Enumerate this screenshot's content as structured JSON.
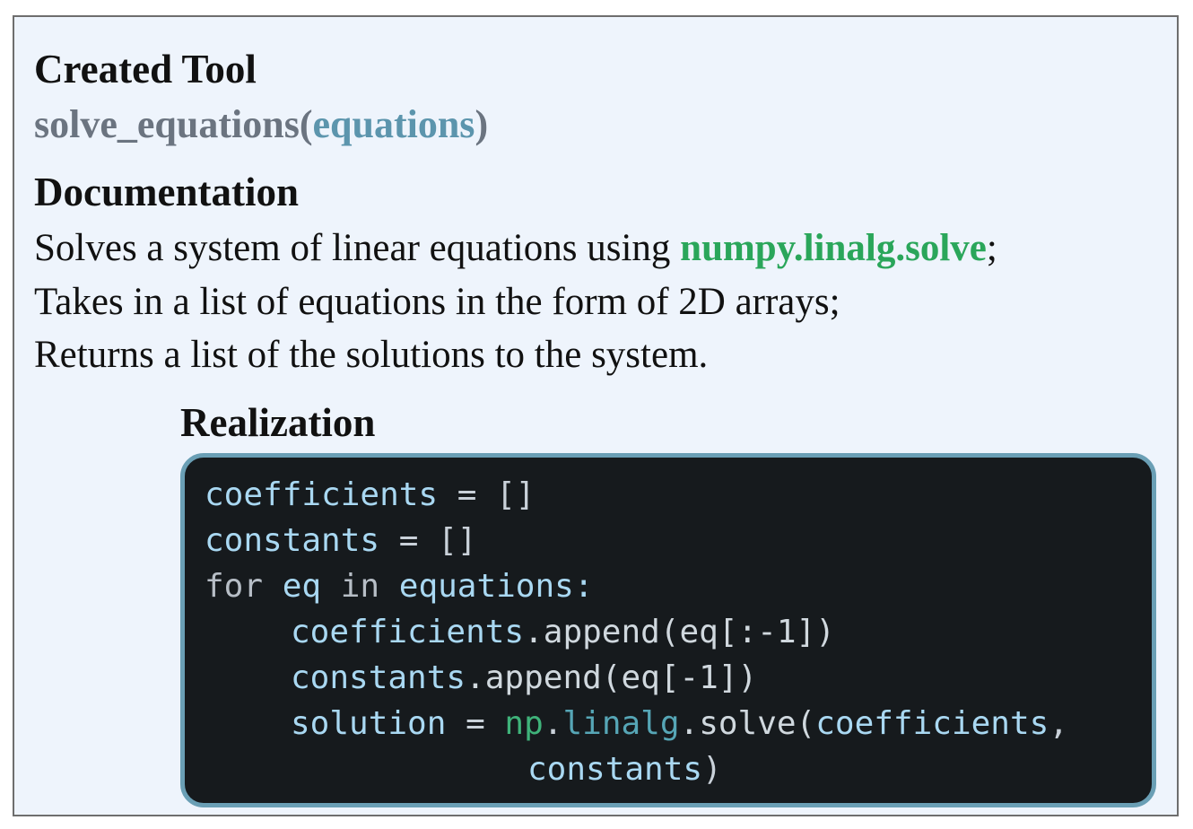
{
  "created_tool": {
    "heading": "Created Tool",
    "function_name": "solve_equations(",
    "argument": "equations",
    "close_paren": ")"
  },
  "documentation": {
    "heading": "Documentation",
    "line1_prefix": "Solves a system of linear equations using ",
    "line1_highlight": "numpy.linalg.solve",
    "line1_suffix": ";",
    "line2": "Takes in a list of equations in the form of 2D arrays;",
    "line3": "Returns a list of the solutions to the system."
  },
  "realization": {
    "heading": "Realization",
    "code": {
      "l1_var": "coefficients",
      "l1_op": " = []",
      "l2_var": "constants",
      "l2_op": " = []",
      "l3_for": "for",
      "l3_eq": " eq ",
      "l3_in": "in",
      "l3_rest": " equations:",
      "l4_var": "coefficients",
      "l4_call": ".append(eq[:-1])",
      "l5_var": "constants",
      "l5_call": ".append(eq[-1])",
      "l6_var": "solution",
      "l6_op": " = ",
      "l6_np": "np",
      "l6_dot1": ".",
      "l6_linalg": "linalg",
      "l6_solve": ".solve(",
      "l6_arg": "coefficients",
      "l6_comma": ",",
      "l7_arg": "constants",
      "l7_close": ")"
    },
    "colors": {
      "background": "#161a1d",
      "border": "#6a9fb5"
    }
  }
}
